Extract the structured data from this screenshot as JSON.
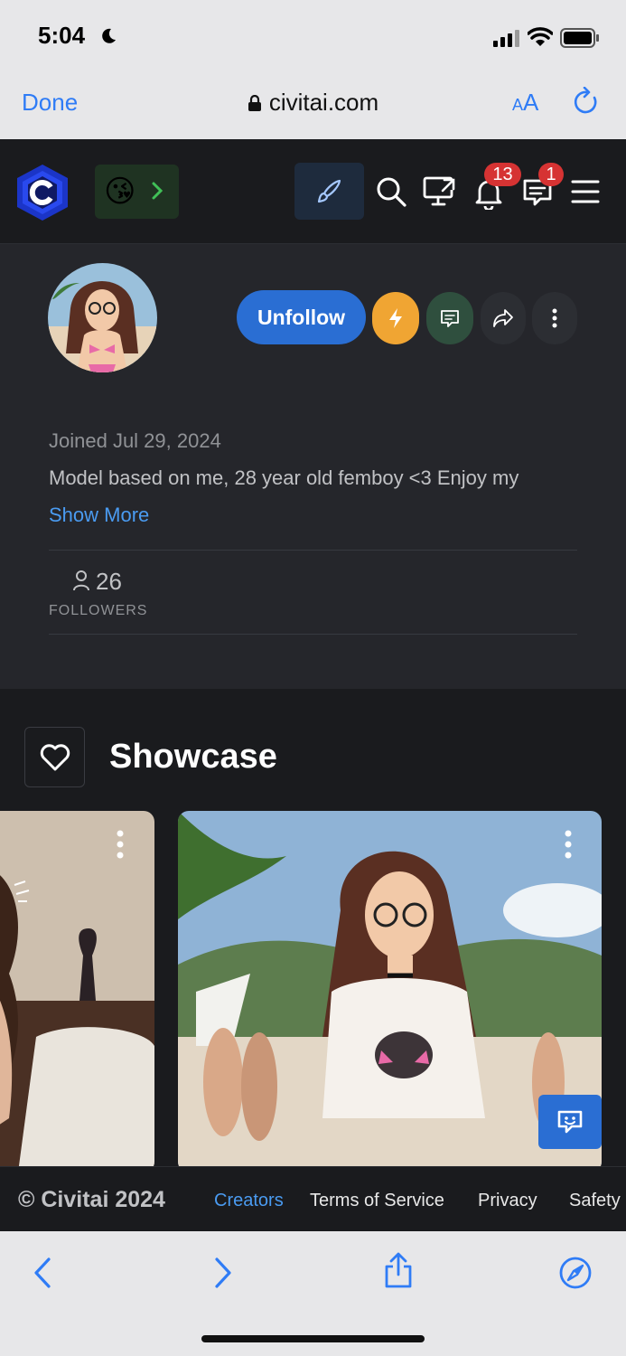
{
  "status_bar": {
    "time": "5:04"
  },
  "browser": {
    "done_label": "Done",
    "url": "civitai.com",
    "aa_small": "A",
    "aa_large": "A"
  },
  "header": {
    "emoji": "😘",
    "notifications_count": "13",
    "messages_count": "1"
  },
  "profile": {
    "unfollow_label": "Unfollow",
    "joined": "Joined Jul 29, 2024",
    "bio": "Model based on me, 28 year old femboy <3 Enjoy my",
    "show_more": "Show More",
    "followers_count": "26",
    "followers_label": "FOLLOWERS"
  },
  "showcase": {
    "title": "Showcase"
  },
  "footer": {
    "copyright": "© Civitai 2024",
    "links": [
      "Creators",
      "Terms of Service",
      "Privacy",
      "Safety"
    ]
  },
  "colors": {
    "accent_blue": "#2a6ed3",
    "tip_orange": "#f0a533",
    "message_green": "#2f4f3e",
    "badge_red": "#d63333",
    "link_blue": "#4a9bf1",
    "ios_blue": "#2f7cf6"
  },
  "icons": [
    "moon-icon",
    "signal-icon",
    "wifi-icon",
    "battery-icon",
    "lock-icon",
    "reload-icon",
    "civitai-logo",
    "chevron-right-icon",
    "brush-icon",
    "search-icon",
    "monitor-icon",
    "bell-icon",
    "chat-icon",
    "menu-icon",
    "bolt-icon",
    "message-icon",
    "share-icon",
    "more-vertical-icon",
    "user-icon",
    "heart-icon",
    "back-icon",
    "forward-icon",
    "share-sheet-icon",
    "compass-icon"
  ]
}
